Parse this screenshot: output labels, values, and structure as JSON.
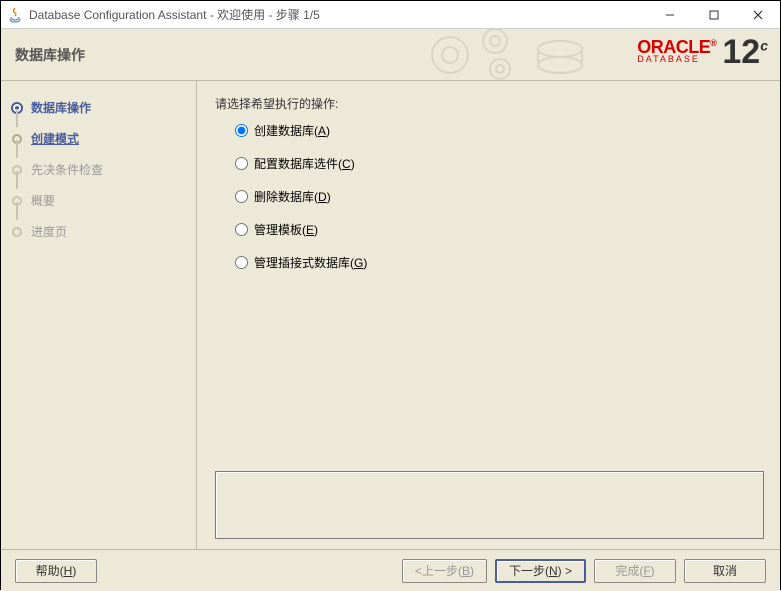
{
  "titlebar": {
    "title": "Database Configuration Assistant - 欢迎使用 - 步骤 1/5"
  },
  "header": {
    "page_title": "数据库操作",
    "brand_top": "ORACLE",
    "brand_bottom": "DATABASE",
    "brand_version": "12",
    "brand_edition": "c"
  },
  "sidebar": {
    "items": [
      {
        "label": "数据库操作"
      },
      {
        "label": "创建模式"
      },
      {
        "label": "先决条件检查"
      },
      {
        "label": "概要"
      },
      {
        "label": "进度页"
      }
    ]
  },
  "main": {
    "prompt": "请选择希望执行的操作:",
    "options": [
      {
        "label": "创建数据库",
        "accel": "A"
      },
      {
        "label": "配置数据库选件",
        "accel": "C"
      },
      {
        "label": "删除数据库",
        "accel": "D"
      },
      {
        "label": "管理模板",
        "accel": "E"
      },
      {
        "label": "管理插接式数据库",
        "accel": "G"
      }
    ]
  },
  "footer": {
    "help": "帮助",
    "help_accel": "H",
    "back": "上一步",
    "back_accel": "B",
    "next": "下一步",
    "next_accel": "N",
    "finish": "完成",
    "finish_accel": "F",
    "cancel": "取消"
  }
}
